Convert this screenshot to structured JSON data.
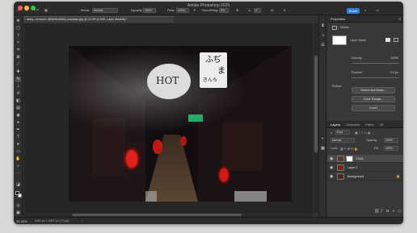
{
  "window": {
    "title": "Adobe Photoshop 2025",
    "share_label": "Share"
  },
  "options_bar": {
    "mode_label": "Mode:",
    "mode_value": "Normal",
    "opacity_label": "Opacity:",
    "opacity_value": "100%",
    "flow_label": "Flow:",
    "flow_value": "100%",
    "smoothing_label": "Smoothing:",
    "smoothing_value": "0%",
    "angle_value": "0°"
  },
  "document_tab": {
    "label": "daisy--nensche-J6BAStuW6tQ-unsplash.jpg @ 33.3% (CS45, Layer Mask/8) *"
  },
  "status_bar": {
    "zoom": "33.33%",
    "doc_info": "3461 px x 2307 px (72 ppi)"
  },
  "sign_text": {
    "hot": "HOT",
    "vertical_1": "ふぢ",
    "vertical_2": "ま",
    "vertical_3": "きんち"
  },
  "properties": {
    "title": "Properties",
    "mask_section": "Masks",
    "layer_mask_label": "Layer Mask",
    "density_label": "Density:",
    "density_value": "100%",
    "feather_label": "Feather:",
    "feather_value": "0.0 px",
    "refine_label": "Refine:",
    "select_mask_label": "Select and Mask...",
    "color_range_label": "Color Range...",
    "invert_label": "Invert"
  },
  "layers": {
    "tabs": [
      "Layers",
      "Channels",
      "Paths",
      "3D"
    ],
    "kind_label": "Kind",
    "blend_mode": "Normal",
    "opacity_label": "Opacity:",
    "opacity_value": "100%",
    "lock_label": "Lock:",
    "fill_label": "Fill:",
    "fill_value": "100%",
    "items": [
      {
        "name": "CS45"
      },
      {
        "name": "Layer 1"
      },
      {
        "name": "Background"
      }
    ]
  },
  "colors": {
    "accent": "#2d7de0",
    "lantern_red": "#e0201a",
    "ui_dark": "#323232"
  }
}
